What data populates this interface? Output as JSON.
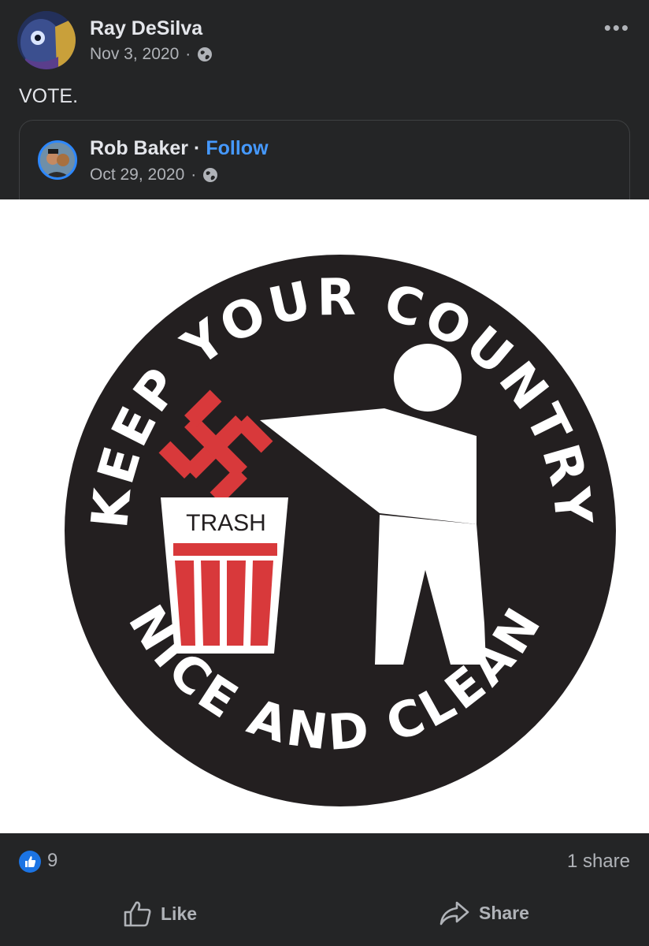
{
  "post": {
    "author": "Ray DeSilva",
    "date": "Nov 3, 2020",
    "separator": "·",
    "privacy_icon": "globe-icon",
    "more_label": "•••",
    "text": "VOTE."
  },
  "shared_post": {
    "author": "Rob Baker",
    "separator": "·",
    "follow_label": "Follow",
    "date": "Oct 29, 2020",
    "privacy_icon": "globe-icon"
  },
  "image": {
    "top_text": "KEEP YOUR COUNTRY",
    "bottom_text": "NICE AND CLEAN",
    "bin_label": "TRASH",
    "colors": {
      "circle": "#231f20",
      "symbol": "#d8393b",
      "figure": "#ffffff"
    }
  },
  "reactions": {
    "count": "9",
    "shares": "1 share",
    "like_icon": "thumbs-up-icon"
  },
  "actions": {
    "like_label": "Like",
    "share_label": "Share"
  },
  "colors": {
    "background": "#242526",
    "accent": "#4599ff",
    "secondary_text": "#b0b3b8"
  }
}
